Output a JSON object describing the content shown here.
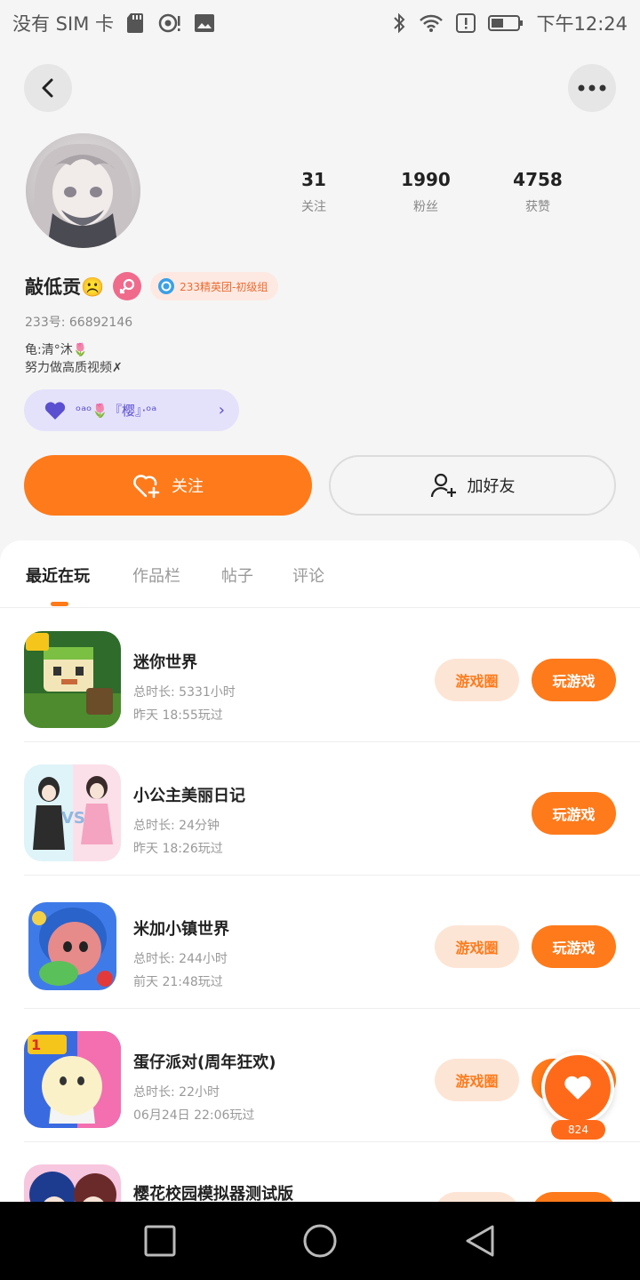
{
  "status_bar": {
    "carrier": "没有 SIM 卡",
    "time": "下午12:24"
  },
  "profile": {
    "stats": [
      {
        "value": "31",
        "label": "关注"
      },
      {
        "value": "1990",
        "label": "粉丝"
      },
      {
        "value": "4758",
        "label": "获赞"
      }
    ],
    "username": "敲低贡☹️",
    "rank_badge": "233精英团-初级组",
    "uid": "233号: 66892146",
    "bio_line1": "龟:清°沐🌷",
    "bio_line2": "努力做高质视频✗",
    "fan_club": "ᵒᵃᵒ🌷『樱』·ᵒᵃ",
    "follow_label": "关注",
    "add_friend_label": "加好友"
  },
  "tabs": [
    {
      "label": "最近在玩",
      "active": true
    },
    {
      "label": "作品栏",
      "active": false
    },
    {
      "label": "帖子",
      "active": false
    },
    {
      "label": "评论",
      "active": false
    }
  ],
  "games": [
    {
      "title": "迷你世界",
      "duration": "总时长: 5331小时",
      "last_played": "昨天 18:55玩过",
      "circle_label": "游戏圈",
      "play_label": "玩游戏"
    },
    {
      "title": "小公主美丽日记",
      "duration": "总时长: 24分钟",
      "last_played": "昨天 18:26玩过",
      "circle_label": "",
      "play_label": "玩游戏"
    },
    {
      "title": "米加小镇世界",
      "duration": "总时长: 244小时",
      "last_played": "前天 21:48玩过",
      "circle_label": "游戏圈",
      "play_label": "玩游戏"
    },
    {
      "title": "蛋仔派对(周年狂欢)",
      "duration": "总时长: 22小时",
      "last_played": "06月24日 22:06玩过",
      "circle_label": "游戏圈",
      "play_label": "玩游戏"
    },
    {
      "title": "樱花校园模拟器测试版",
      "duration": "",
      "last_played": "",
      "circle_label": "",
      "play_label": ""
    }
  ],
  "float_like": {
    "count": "824"
  },
  "colors": {
    "accent": "#ff7a1a",
    "accent_light": "#fde5d6",
    "fanclub_bg": "#e4e1fb"
  }
}
